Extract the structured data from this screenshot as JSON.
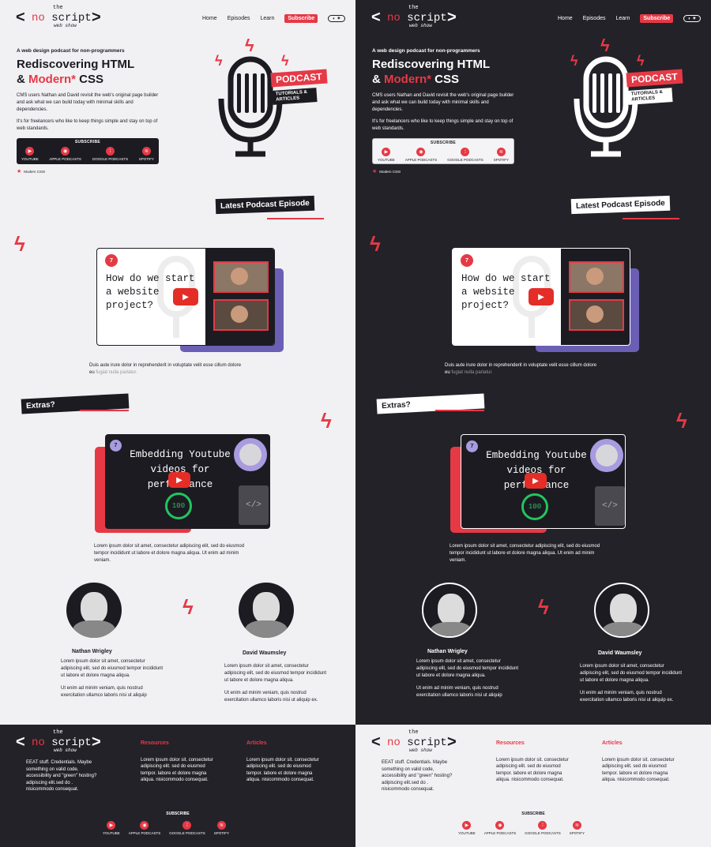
{
  "logo": {
    "the": "the",
    "no": "no",
    "script": "script",
    "web_show": "web show"
  },
  "nav": {
    "home": "Home",
    "episodes": "Episodes",
    "learn": "Learn",
    "subscribe": "Subscribe",
    "toggle": "◐ ✷"
  },
  "hero": {
    "kicker": "A web design podcast for non-programmers",
    "title_line1": "Rediscovering HTML",
    "title_amp": "& ",
    "title_modern": "Modern*",
    "title_css": " CSS",
    "intro_p1": "CMS users Nathan and David revisit the web's original page builder and ask what we can build today with minimal skills and dependencies.",
    "intro_p2": "It's for freelancers who like to keep things simple and stay on top of web standards.",
    "subscribe_title": "SUBSCRIBE",
    "platforms": [
      {
        "label": "YOUTUBE",
        "icon": "youtube-icon",
        "glyph": "▶"
      },
      {
        "label": "APPLE PODCASTS",
        "icon": "apple-podcasts-icon",
        "glyph": "◉"
      },
      {
        "label": "GOOGLE PODCASTS",
        "icon": "google-podcasts-icon",
        "glyph": "⁞"
      },
      {
        "label": "SPOTIFY",
        "icon": "spotify-icon",
        "glyph": "≋"
      }
    ],
    "note": "Modern CSS!",
    "badge_podcast": "PODCAST",
    "badge_sub1": "TUTORIALS &",
    "badge_sub2": "ARTICLES"
  },
  "latest": {
    "heading": "Latest Podcast Episode",
    "episode_number": "7",
    "episode_title": "How do we start a website project?",
    "description": "Duis aute irure dolor in reprehenderit in voluptate velit esse cillum dolore eu",
    "description_muted": "fugiat nulla pariatur."
  },
  "extras": {
    "heading": "Extras?",
    "number": "7",
    "title": "Embedding Youtube videos for performance",
    "score": "100",
    "file_glyph": "</>",
    "description": "Lorem ipsum dolor sit amet, consectetur adipiscing elit, sed do eiusmod tempor incididunt ut labore et dolore magna aliqua. Ut enim ad minim veniam."
  },
  "hosts": [
    {
      "name": "Nathan Wrigley",
      "bio1": "Lorem ipsum dolor sit amet, consectetur adipiscing elit, sed do eiusmod tempor incididunt ut labore et dolore magna aliqua.",
      "bio2": "Ut enim ad minim veniam, quis nostrud exercitation ullamco laboris nisi ut aliquip"
    },
    {
      "name": "David Waumsley",
      "bio1": "Lorem ipsum dolor sit amet, consectetur adipiscing elit, sed do eiusmod tempor incididunt ut labore et dolore magna aliqua.",
      "bio2": "Ut enim ad minim veniam, quis nostrud exercitation ullamco laboris nisi ut aliquip ex."
    }
  ],
  "footer": {
    "about": "EEAT stuff. Credentials. Maybe something on valid code, accessibility and \"green\" hosting? adipiscing elit.sed do . nisicommodo consequat.",
    "resources_heading": "Resources",
    "resources_text": "Lorem ipsum dolor sit. consectetur adipiscing elit. sed do eiusmod tempor. labore et dolore magna aliqua. nisicommodo consequat.",
    "articles_heading": "Articles",
    "articles_text": "Lorem ipsum dolor sit. consectetur adipiscing elit. sed do eiusmod tempor. labore et dolore magna aliqua. nisicommodo consequat.",
    "subscribe": "SUBSCRIBE"
  },
  "colors": {
    "accent": "#e63946",
    "purple": "#6b5fb5",
    "green": "#22c55e",
    "dark": "#1c1b22",
    "light": "#f1f1f3"
  }
}
